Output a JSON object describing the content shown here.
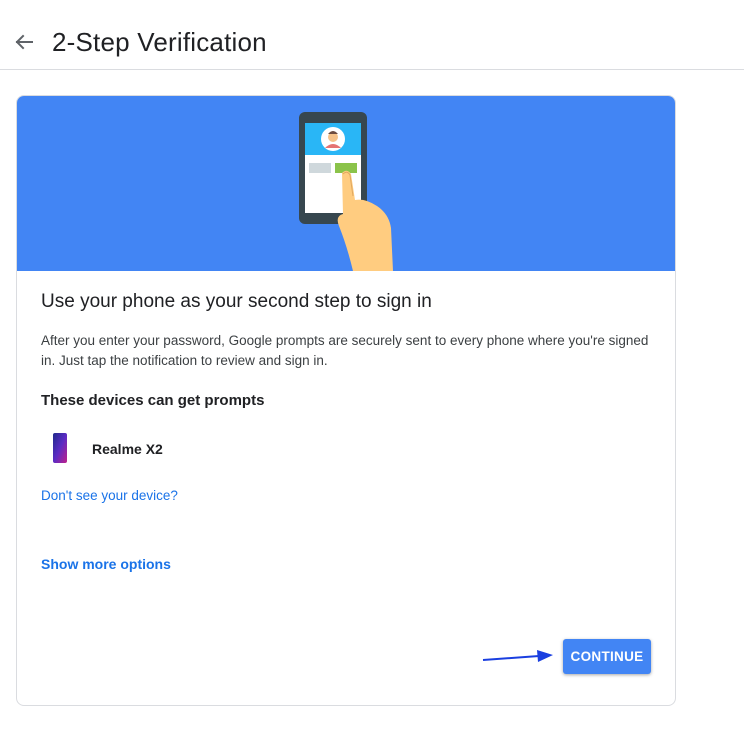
{
  "header": {
    "title": "2-Step Verification",
    "back_icon": "arrow-back-icon"
  },
  "card": {
    "heading": "Use your phone as your second step to sign in",
    "description": "After you enter your password, Google prompts are securely sent to every phone where you're signed in. Just tap the notification to review and sign in.",
    "devices_heading": "These devices can get prompts",
    "devices": [
      {
        "name": "Realme X2",
        "icon": "smartphone-icon"
      }
    ],
    "missing_device_link": "Don't see your device?",
    "more_options_link": "Show more options",
    "continue_label": "CONTINUE"
  },
  "colors": {
    "accent": "#4285f4",
    "link": "#1a73e8",
    "annotation_arrow": "#1a3fe0"
  }
}
